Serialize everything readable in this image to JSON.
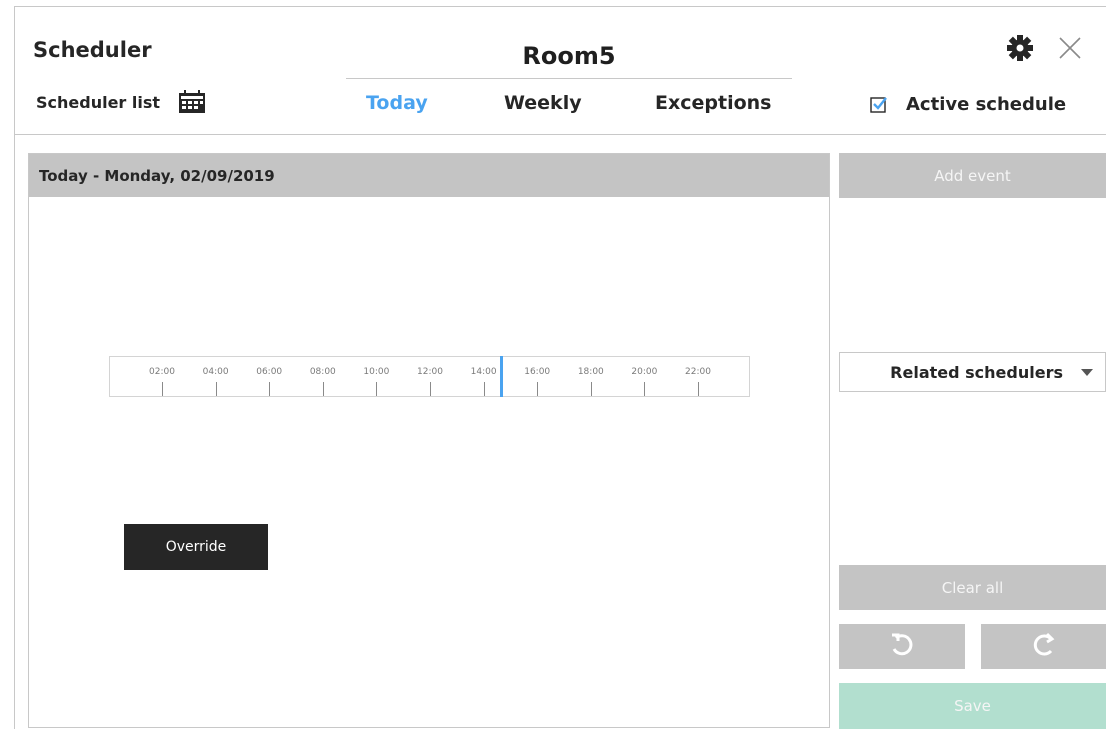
{
  "app_title": "Scheduler",
  "room_title": "Room5",
  "scheduler_list": {
    "label": "Scheduler list",
    "icon": "calendar-icon"
  },
  "tabs": [
    {
      "label": "Today",
      "active": true
    },
    {
      "label": "Weekly",
      "active": false
    },
    {
      "label": "Exceptions",
      "active": false
    }
  ],
  "header_icons": {
    "settings": "gear-icon",
    "close": "close-icon"
  },
  "active_schedule": {
    "label": "Active schedule",
    "checked": true
  },
  "panel": {
    "title": "Today - Monday, 02/09/2019"
  },
  "timeline": {
    "ticks": [
      "02:00",
      "04:00",
      "06:00",
      "08:00",
      "10:00",
      "12:00",
      "14:00",
      "16:00",
      "18:00",
      "20:00",
      "22:00"
    ],
    "current_time_hours": 14.6
  },
  "override_label": "Override",
  "sidebar": {
    "add_event": "Add event",
    "related_schedulers": "Related schedulers",
    "clear_all": "Clear all",
    "undo_icon": "undo-icon",
    "redo_icon": "redo-icon",
    "save": "Save"
  },
  "colors": {
    "accent": "#4aa3f0",
    "button_gray": "#c4c4c4",
    "save_green": "#b2dfcf",
    "override_dark": "#262626"
  }
}
